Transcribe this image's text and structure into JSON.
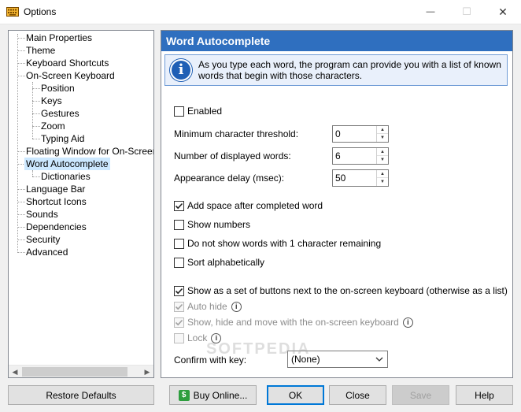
{
  "window": {
    "title": "Options",
    "minimize_glyph": "—",
    "maximize_glyph": "☐",
    "close_glyph": "✕"
  },
  "tree": {
    "items": [
      {
        "label": "Main Properties"
      },
      {
        "label": "Theme"
      },
      {
        "label": "Keyboard Shortcuts"
      },
      {
        "label": "On-Screen Keyboard"
      },
      {
        "label": "Position"
      },
      {
        "label": "Keys"
      },
      {
        "label": "Gestures"
      },
      {
        "label": "Zoom"
      },
      {
        "label": "Typing Aid"
      },
      {
        "label": "Floating Window for On-Screen Ke"
      },
      {
        "label": "Word Autocomplete"
      },
      {
        "label": "Dictionaries"
      },
      {
        "label": "Language Bar"
      },
      {
        "label": "Shortcut Icons"
      },
      {
        "label": "Sounds"
      },
      {
        "label": "Dependencies"
      },
      {
        "label": "Security"
      },
      {
        "label": "Advanced"
      }
    ],
    "selected": "Word Autocomplete"
  },
  "panel": {
    "title": "Word Autocomplete",
    "info": "As you type each word, the program can provide you with a list of known words that begin with those characters.",
    "enabled_label": "Enabled",
    "min_threshold_label": "Minimum character threshold:",
    "min_threshold_value": "0",
    "displayed_words_label": "Number of displayed words:",
    "displayed_words_value": "6",
    "delay_label": "Appearance delay (msec):",
    "delay_value": "50",
    "add_space_label": "Add space after completed word",
    "show_numbers_label": "Show numbers",
    "no_show_one_label": "Do not show words with 1 character remaining",
    "sort_label": "Sort alphabetically",
    "show_buttons_label": "Show as a set of buttons next to the on-screen keyboard (otherwise as a list)",
    "auto_hide_label": "Auto hide",
    "show_hide_move_label": "Show, hide and move with the on-screen keyboard",
    "lock_label": "Lock",
    "confirm_label": "Confirm with key:",
    "confirm_value": "(None)"
  },
  "buttons": {
    "restore": "Restore Defaults",
    "buy": "Buy Online...",
    "ok": "OK",
    "close": "Close",
    "save": "Save",
    "help": "Help"
  },
  "watermark": "SOFTPEDIA",
  "colors": {
    "header_bg": "#2f6fbf",
    "selection": "#cce8ff",
    "default_button_border": "#0078d7"
  }
}
